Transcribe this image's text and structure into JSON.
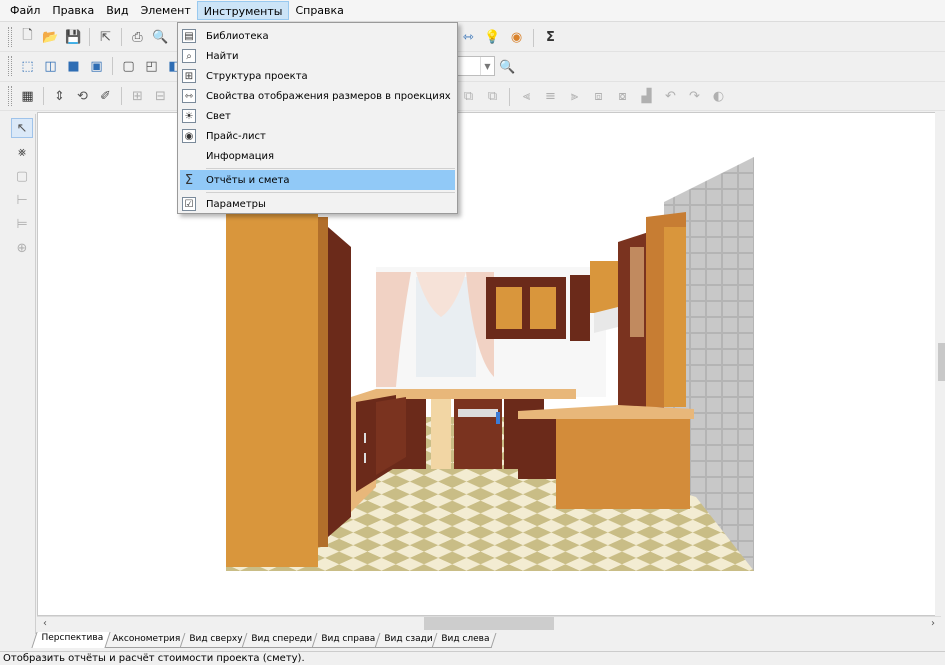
{
  "menubar": {
    "items": [
      {
        "label": "Файл"
      },
      {
        "label": "Правка"
      },
      {
        "label": "Вид"
      },
      {
        "label": "Элемент"
      },
      {
        "label": "Инструменты"
      },
      {
        "label": "Справка"
      }
    ],
    "active_index": 4
  },
  "tools_menu": {
    "items": [
      {
        "label": "Библиотека",
        "icon": "library-icon"
      },
      {
        "label": "Найти",
        "icon": "find-icon"
      },
      {
        "label": "Структура проекта",
        "icon": "project-structure-icon"
      },
      {
        "label": "Свойства отображения размеров в проекциях",
        "icon": "dimension-properties-icon"
      },
      {
        "label": "Свет",
        "icon": "light-icon"
      },
      {
        "label": "Прайс-лист",
        "icon": "price-list-icon"
      },
      {
        "label": "Информация",
        "icon": ""
      },
      {
        "label": "Отчёты и смета",
        "icon": "sigma-icon"
      },
      {
        "label": "Параметры",
        "icon": "parameters-icon"
      }
    ],
    "highlighted": "Отчёты и смета"
  },
  "view_tabs": [
    {
      "label": "Перспектива"
    },
    {
      "label": "Аксонометрия"
    },
    {
      "label": "Вид сверху"
    },
    {
      "label": "Вид спереди"
    },
    {
      "label": "Вид справа"
    },
    {
      "label": "Вид сзади"
    },
    {
      "label": "Вид слева"
    }
  ],
  "active_tab": "Перспектива",
  "status": {
    "text": "Отобразить отчёты и расчёт стоимости проекта (смету)."
  },
  "colors": {
    "menu_highlight": "#91c9f7",
    "menubar_active": "#cce4f7",
    "wood_light": "#d9963c",
    "wood_dark": "#6b2a1a",
    "floor_light": "#f3ecd2",
    "floor_dark": "#c9bd86"
  }
}
